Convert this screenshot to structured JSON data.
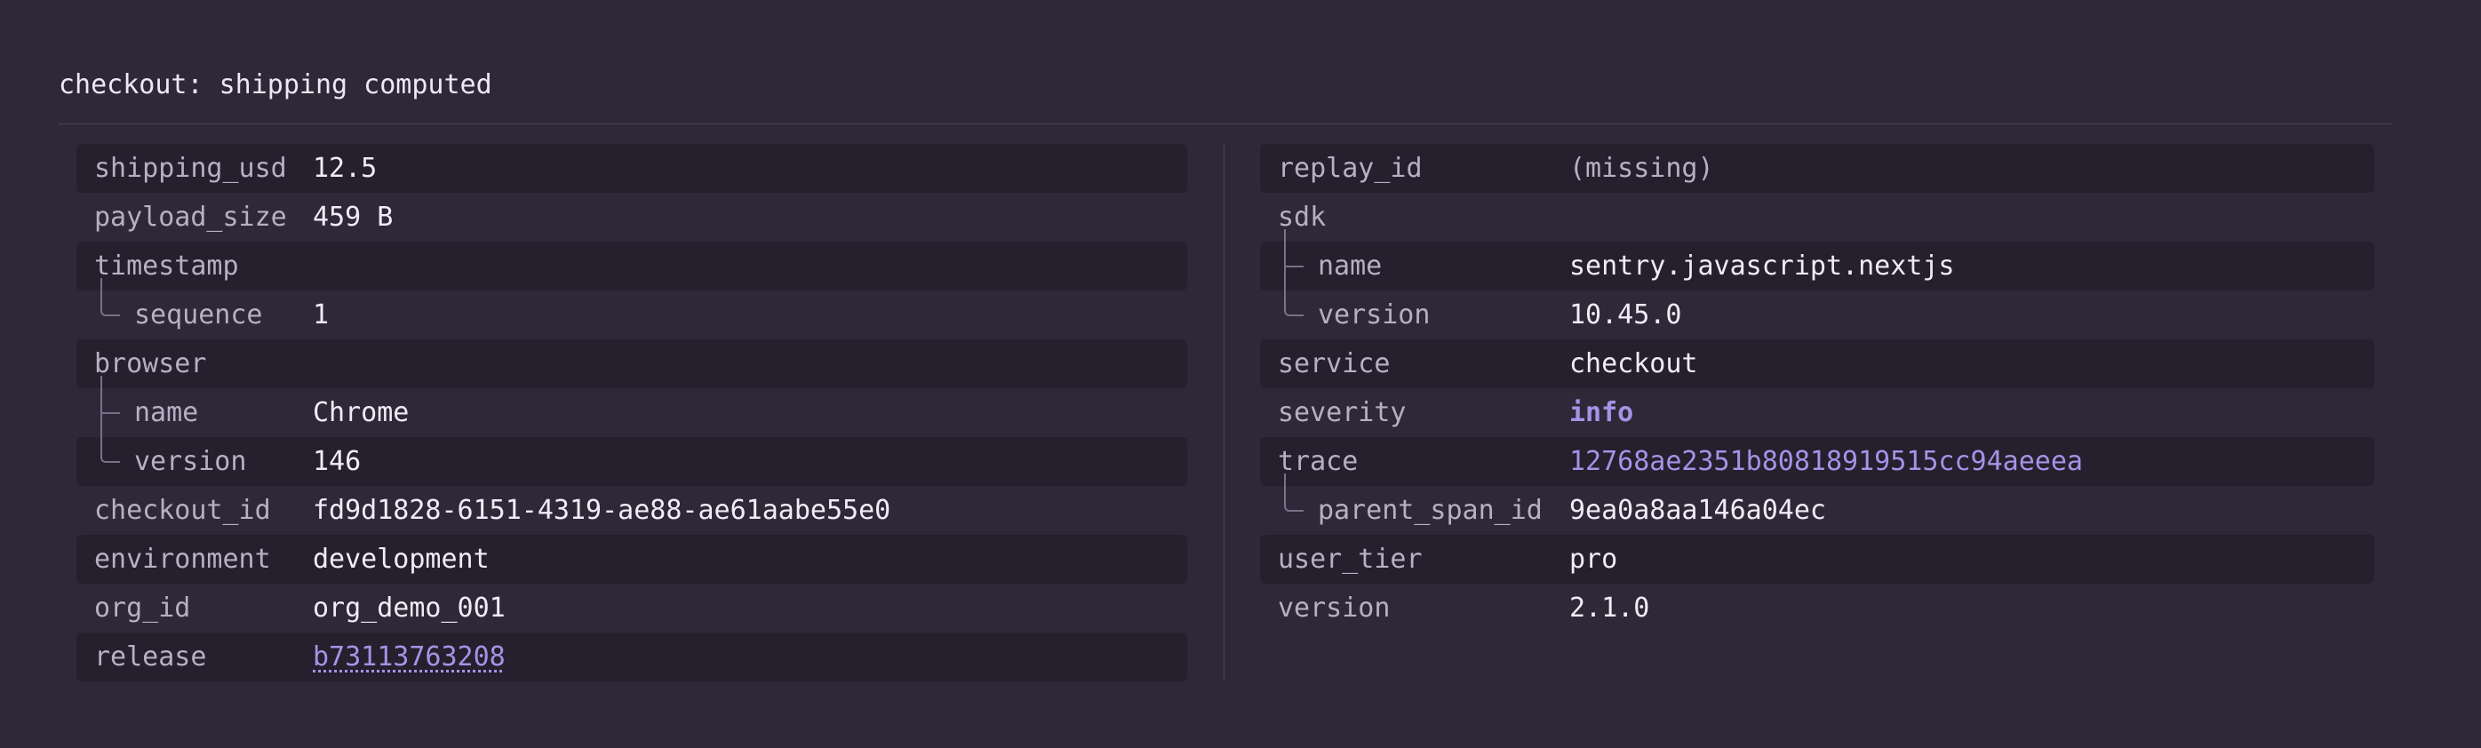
{
  "title": "checkout: shipping computed",
  "colors": {
    "background": "#2d2938",
    "row_stripe": "#24202d",
    "accent": "#a493e6",
    "key_text": "#b6b0c4",
    "value_text": "#f0ecf7"
  },
  "left": {
    "rows": [
      {
        "key": "shipping_usd",
        "value": "12.5"
      },
      {
        "key": "payload_size",
        "value": "459 B"
      },
      {
        "key": "timestamp",
        "value": ""
      },
      {
        "key": "sequence",
        "value": "1"
      },
      {
        "key": "browser",
        "value": ""
      },
      {
        "key": "name",
        "value": "Chrome"
      },
      {
        "key": "version",
        "value": "146"
      },
      {
        "key": "checkout_id",
        "value": "fd9d1828-6151-4319-ae88-ae61aabe55e0"
      },
      {
        "key": "environment",
        "value": "development"
      },
      {
        "key": "org_id",
        "value": "org_demo_001"
      },
      {
        "key": "release",
        "value": "b73113763208"
      }
    ]
  },
  "right": {
    "rows": [
      {
        "key": "replay_id",
        "value": "(missing)"
      },
      {
        "key": "sdk",
        "value": ""
      },
      {
        "key": "name",
        "value": "sentry.javascript.nextjs"
      },
      {
        "key": "version",
        "value": "10.45.0"
      },
      {
        "key": "service",
        "value": "checkout"
      },
      {
        "key": "severity",
        "value": "info"
      },
      {
        "key": "trace",
        "value": "12768ae2351b80818919515cc94aeeea"
      },
      {
        "key": "parent_span_id",
        "value": "9ea0a8aa146a04ec"
      },
      {
        "key": "user_tier",
        "value": "pro"
      },
      {
        "key": "version",
        "value": "2.1.0"
      }
    ]
  }
}
